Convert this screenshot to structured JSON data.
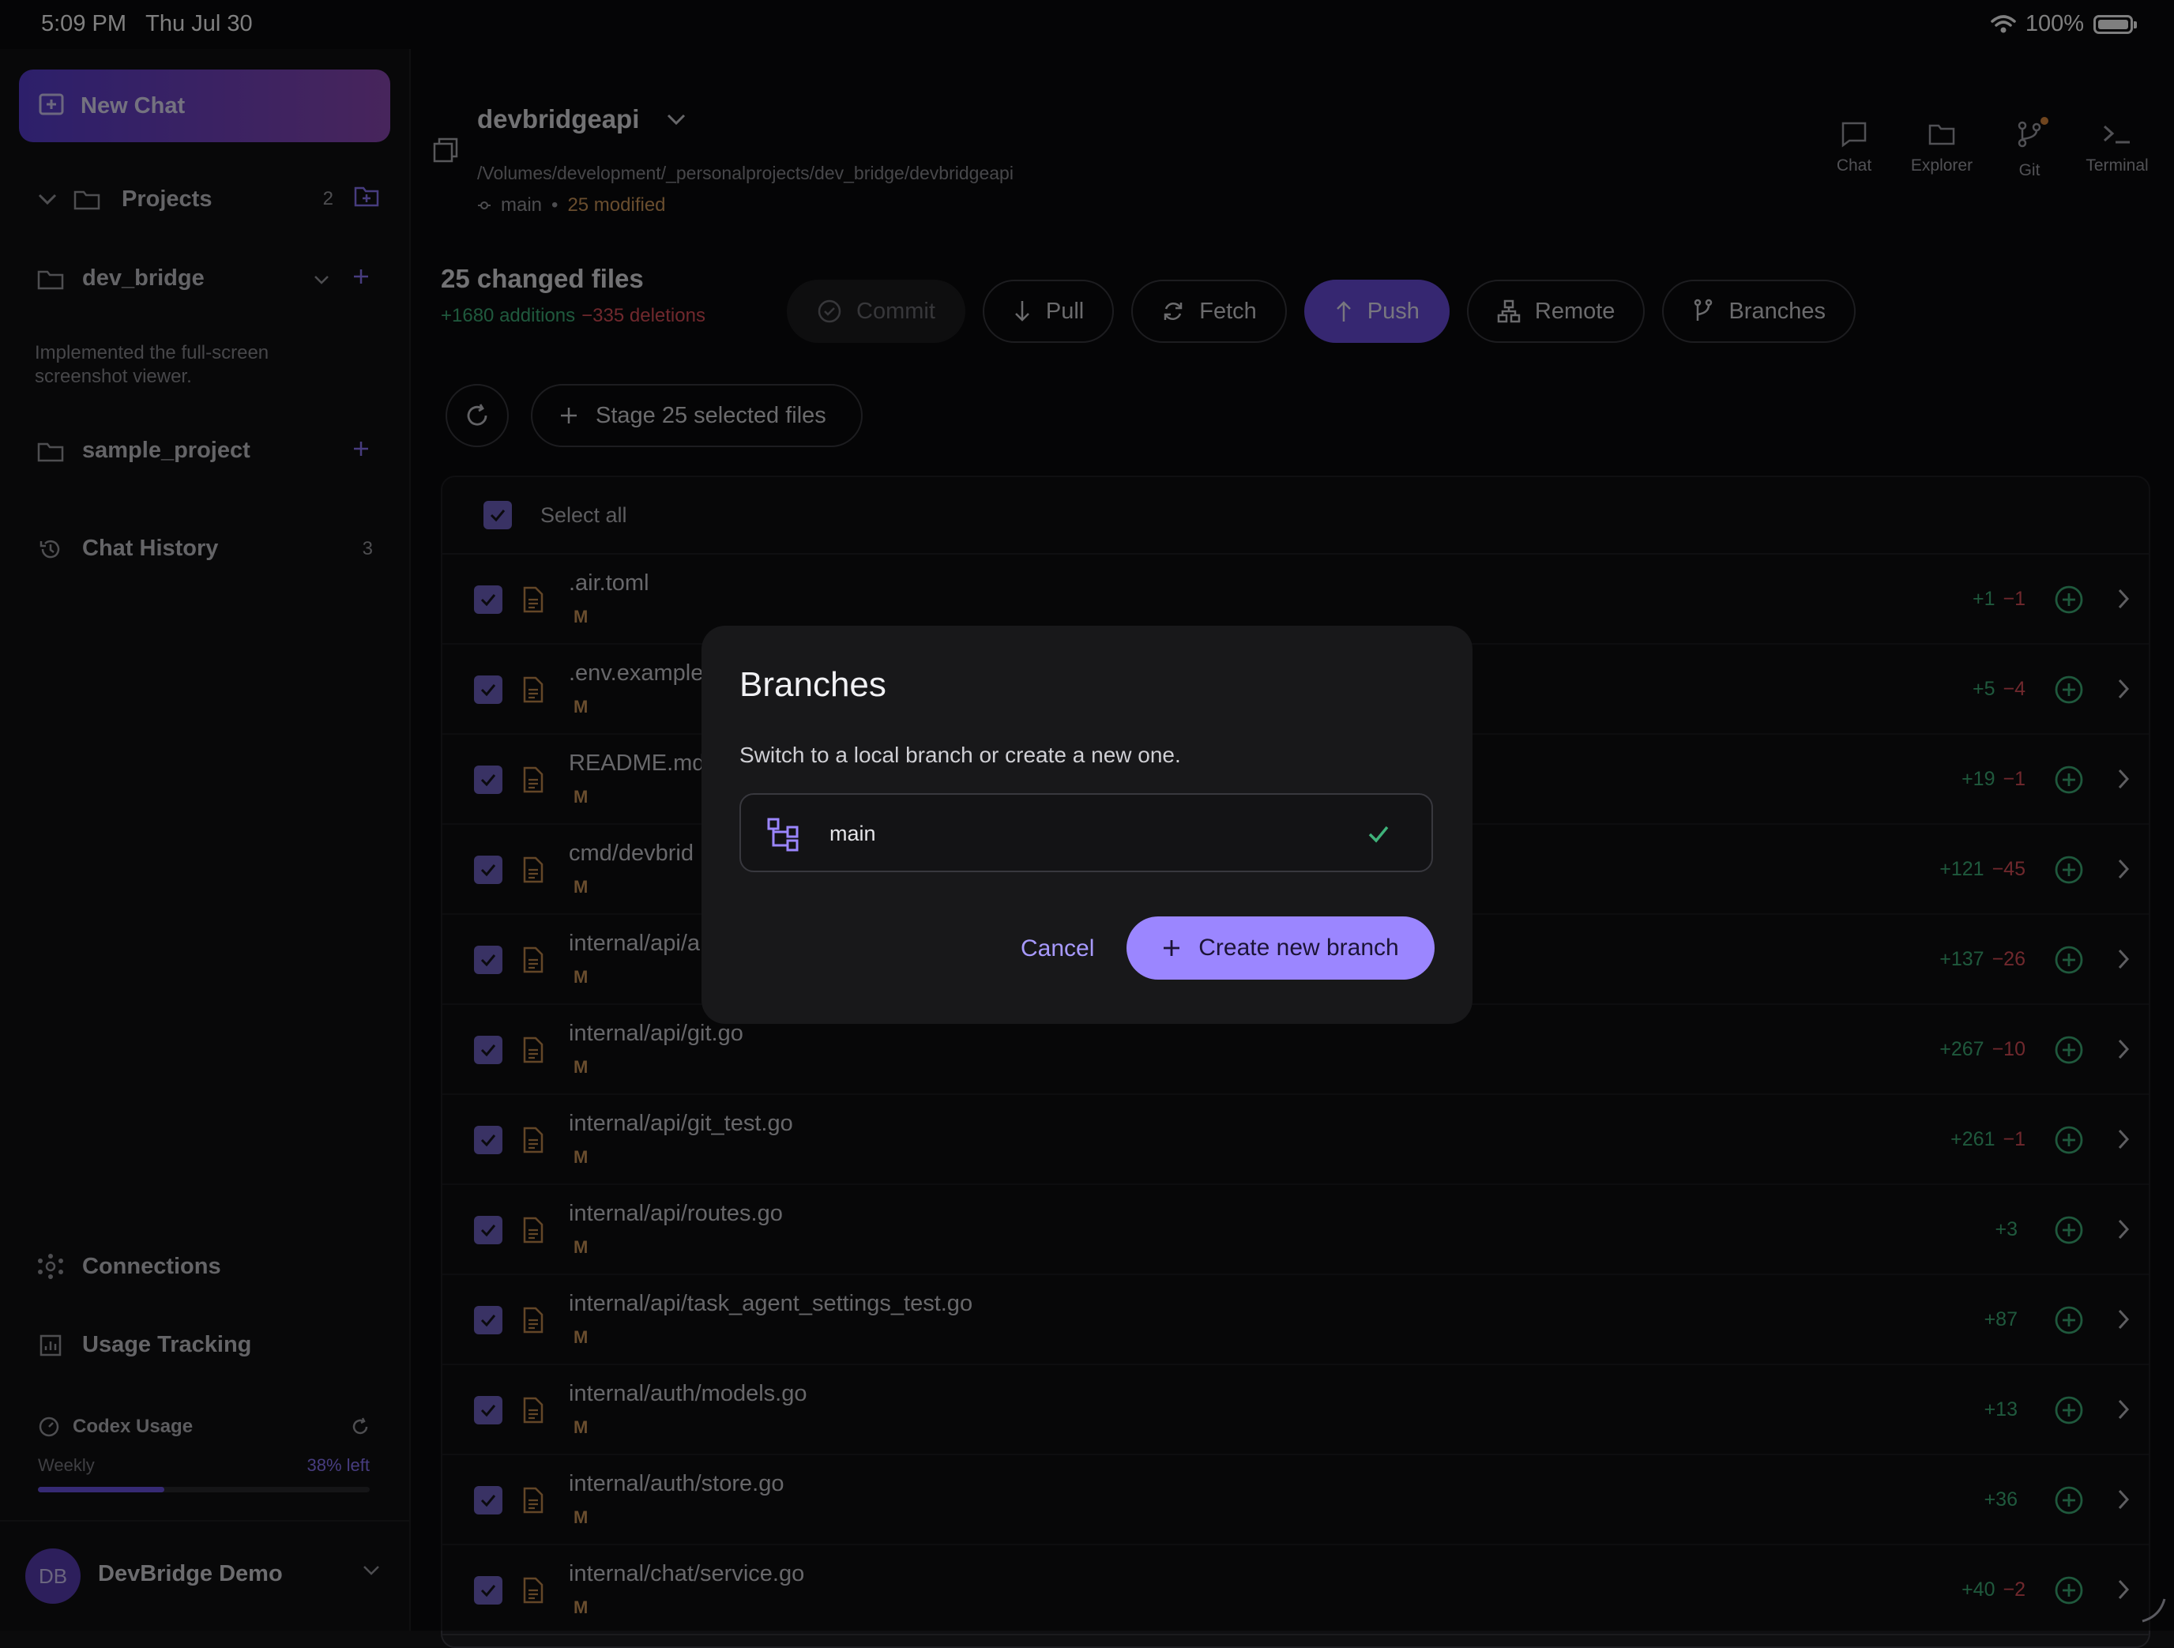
{
  "status_bar": {
    "time": "5:09 PM",
    "date": "Thu Jul 30",
    "battery": "100%"
  },
  "sidebar": {
    "new_chat": "New Chat",
    "projects_label": "Projects",
    "projects_count": "2",
    "project1": {
      "name": "dev_bridge",
      "description": "Implemented the full-screen screenshot viewer."
    },
    "project2": {
      "name": "sample_project"
    },
    "chat_history_label": "Chat History",
    "chat_history_count": "3",
    "connections": "Connections",
    "usage_tracking": "Usage Tracking",
    "codex_usage": {
      "title": "Codex Usage",
      "period": "Weekly",
      "left": "38% left",
      "used_fraction": 0.38
    },
    "user": {
      "initials": "DB",
      "name": "DevBridge Demo"
    }
  },
  "header": {
    "repo_name": "devbridgeapi",
    "repo_path": "/Volumes/development/_personalprojects/dev_bridge/devbridgeapi",
    "branch": "main",
    "separator": "•",
    "modified": "25 modified",
    "nav": [
      "Chat",
      "Explorer",
      "Git",
      "Terminal"
    ]
  },
  "summary": {
    "title": "25 changed files",
    "additions": "+1680 additions",
    "deletions": "−335 deletions"
  },
  "actions": {
    "commit": "Commit",
    "pull": "Pull",
    "fetch": "Fetch",
    "push": "Push",
    "remote": "Remote",
    "branches": "Branches"
  },
  "stage_button": "Stage 25 selected files",
  "select_all": "Select all",
  "files": [
    {
      "path": ".air.toml",
      "status": "M",
      "add": "+1",
      "del": "−1"
    },
    {
      "path": ".env.example",
      "status": "M",
      "add": "+5",
      "del": "−4"
    },
    {
      "path": "README.md",
      "status": "M",
      "add": "+19",
      "del": "−1"
    },
    {
      "path": "cmd/devbrid",
      "status": "M",
      "add": "+121",
      "del": "−45"
    },
    {
      "path": "internal/api/a",
      "status": "M",
      "add": "+137",
      "del": "−26"
    },
    {
      "path": "internal/api/git.go",
      "status": "M",
      "add": "+267",
      "del": "−10"
    },
    {
      "path": "internal/api/git_test.go",
      "status": "M",
      "add": "+261",
      "del": "−1"
    },
    {
      "path": "internal/api/routes.go",
      "status": "M",
      "add": "+3",
      "del": ""
    },
    {
      "path": "internal/api/task_agent_settings_test.go",
      "status": "M",
      "add": "+87",
      "del": ""
    },
    {
      "path": "internal/auth/models.go",
      "status": "M",
      "add": "+13",
      "del": ""
    },
    {
      "path": "internal/auth/store.go",
      "status": "M",
      "add": "+36",
      "del": ""
    },
    {
      "path": "internal/chat/service.go",
      "status": "M",
      "add": "+40",
      "del": "−2"
    }
  ],
  "modal": {
    "title": "Branches",
    "subtitle": "Switch to a local branch or create a new one.",
    "branch_name": "main",
    "cancel": "Cancel",
    "create": "Create new branch"
  },
  "colors": {
    "accent": "#6c4fe3",
    "accent_light": "#9b86ff",
    "addition": "#3fb27a",
    "deletion": "#e0505a",
    "modified": "#d39a5c"
  }
}
